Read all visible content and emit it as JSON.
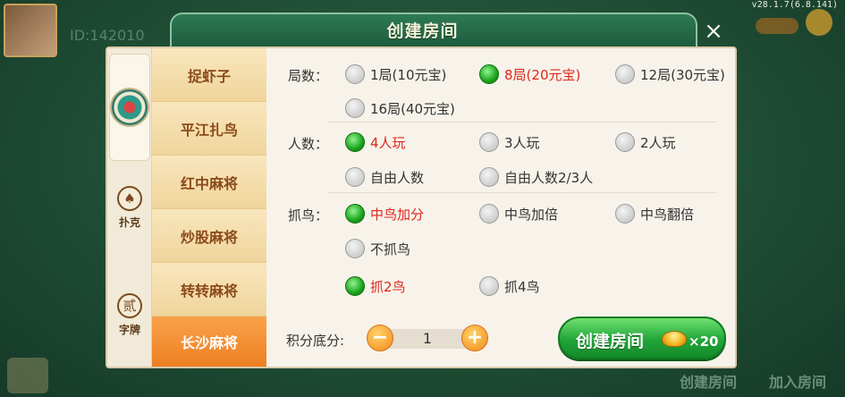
{
  "version": "v28.1.7(6.8.141)",
  "background": {
    "user_id": "ID:142010",
    "bottom_left": "创建房间",
    "bottom_right": "加入房间"
  },
  "dialog": {
    "title": "创建房间",
    "close": "×"
  },
  "categories": [
    {
      "icon": "♠",
      "label": "扑克"
    },
    {
      "icon": "贰",
      "label": "字牌"
    }
  ],
  "games": [
    "捉虾子",
    "平江扎鸟",
    "红中麻将",
    "炒股麻将",
    "转转麻将",
    "长沙麻将"
  ],
  "active_game": "长沙麻将",
  "settings": {
    "rounds": {
      "label": "局数：",
      "options": [
        "1局(10元宝)",
        "8局(20元宝)",
        "12局(30元宝)",
        "16局(40元宝)"
      ],
      "selected": "8局(20元宝)"
    },
    "players": {
      "label": "人数：",
      "options": [
        "4人玩",
        "3人玩",
        "2人玩",
        "自由人数",
        "自由人数2/3人"
      ],
      "selected": "4人玩"
    },
    "bird": {
      "label": "抓鸟：",
      "options": [
        "中鸟加分",
        "中鸟加倍",
        "中鸟翻倍",
        "不抓鸟",
        "抓2鸟",
        "抓4鸟"
      ],
      "selected": [
        "中鸟加分",
        "抓2鸟"
      ]
    }
  },
  "score": {
    "label": "积分底分:",
    "value": "1",
    "minus": "−",
    "plus": "+"
  },
  "create_button": {
    "label": "创建房间",
    "cost": "×20"
  },
  "colors": {
    "selected_text": "#e0261b",
    "active_tab": "#ee7f22",
    "create_button": "#22a53a"
  }
}
